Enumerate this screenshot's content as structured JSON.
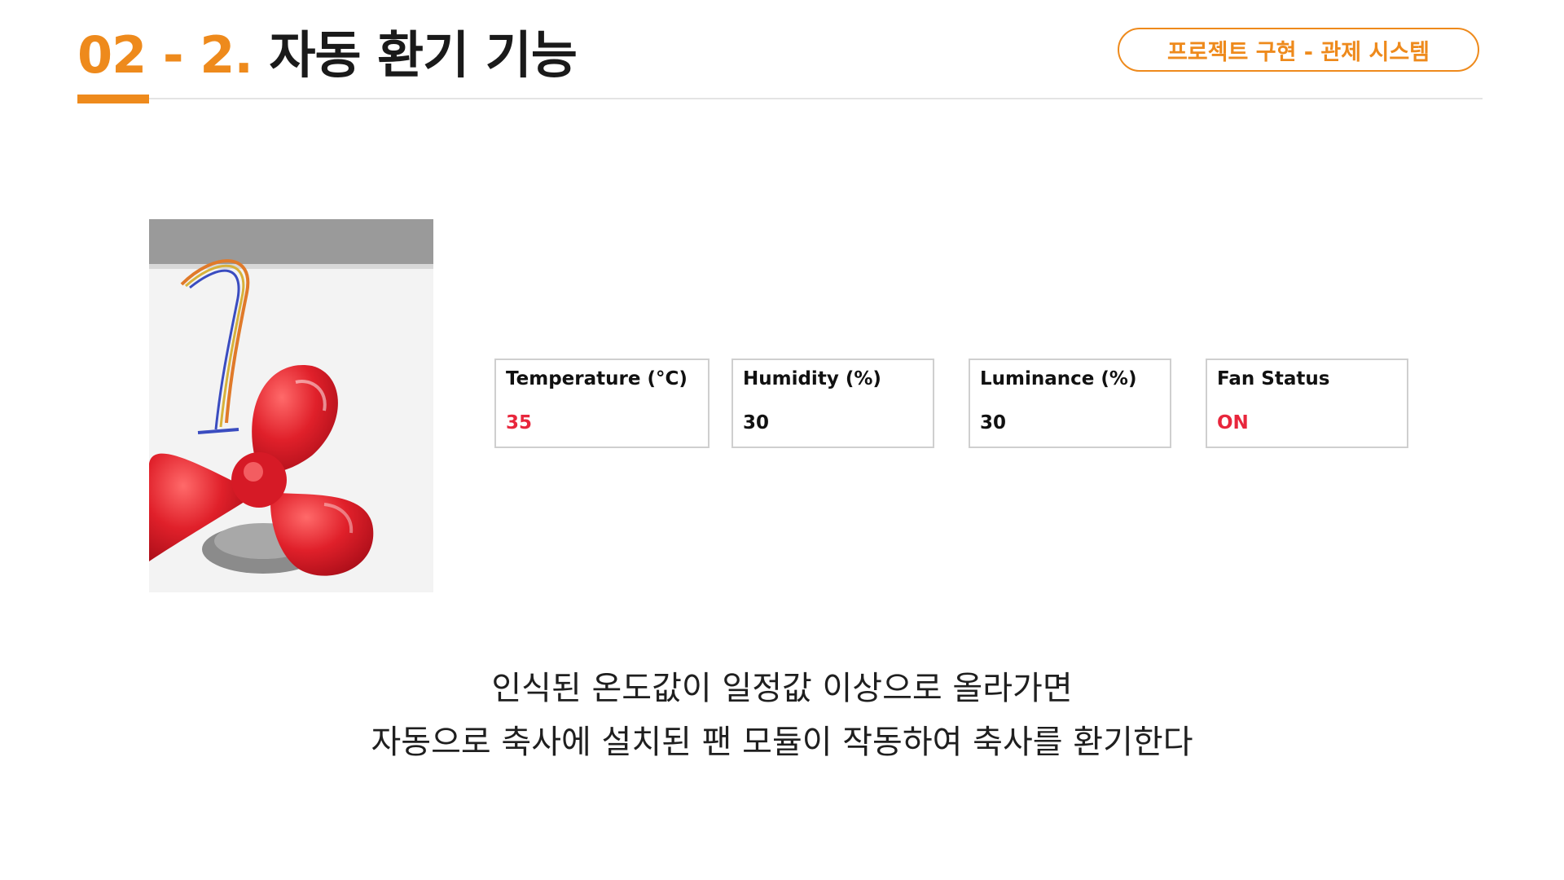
{
  "header": {
    "number": "02",
    "separator": " - ",
    "sub_number": "2.",
    "title_text": " 자동 환기 기능",
    "badge": "프로젝트 구현 - 관제 시스템"
  },
  "photo": {
    "subject": "red-fan-module",
    "colors": {
      "blade": "#e0202a",
      "background": "#ececec"
    }
  },
  "sensors": [
    {
      "label": "Temperature  (°C)",
      "value": "35",
      "alert": true
    },
    {
      "label": "Humidity (%)",
      "value": "30",
      "alert": false
    },
    {
      "label": "Luminance (%)",
      "value": "30",
      "alert": false
    },
    {
      "label": "Fan Status",
      "value": "ON",
      "alert": true
    }
  ],
  "caption": {
    "line1": "인식된 온도값이 일정값 이상으로 올라가면",
    "line2": "자동으로 축사에 설치된 팬 모듈이 작동하여 축사를 환기한다"
  },
  "colors": {
    "accent": "#ee8a1c",
    "alert": "#e8263c"
  }
}
